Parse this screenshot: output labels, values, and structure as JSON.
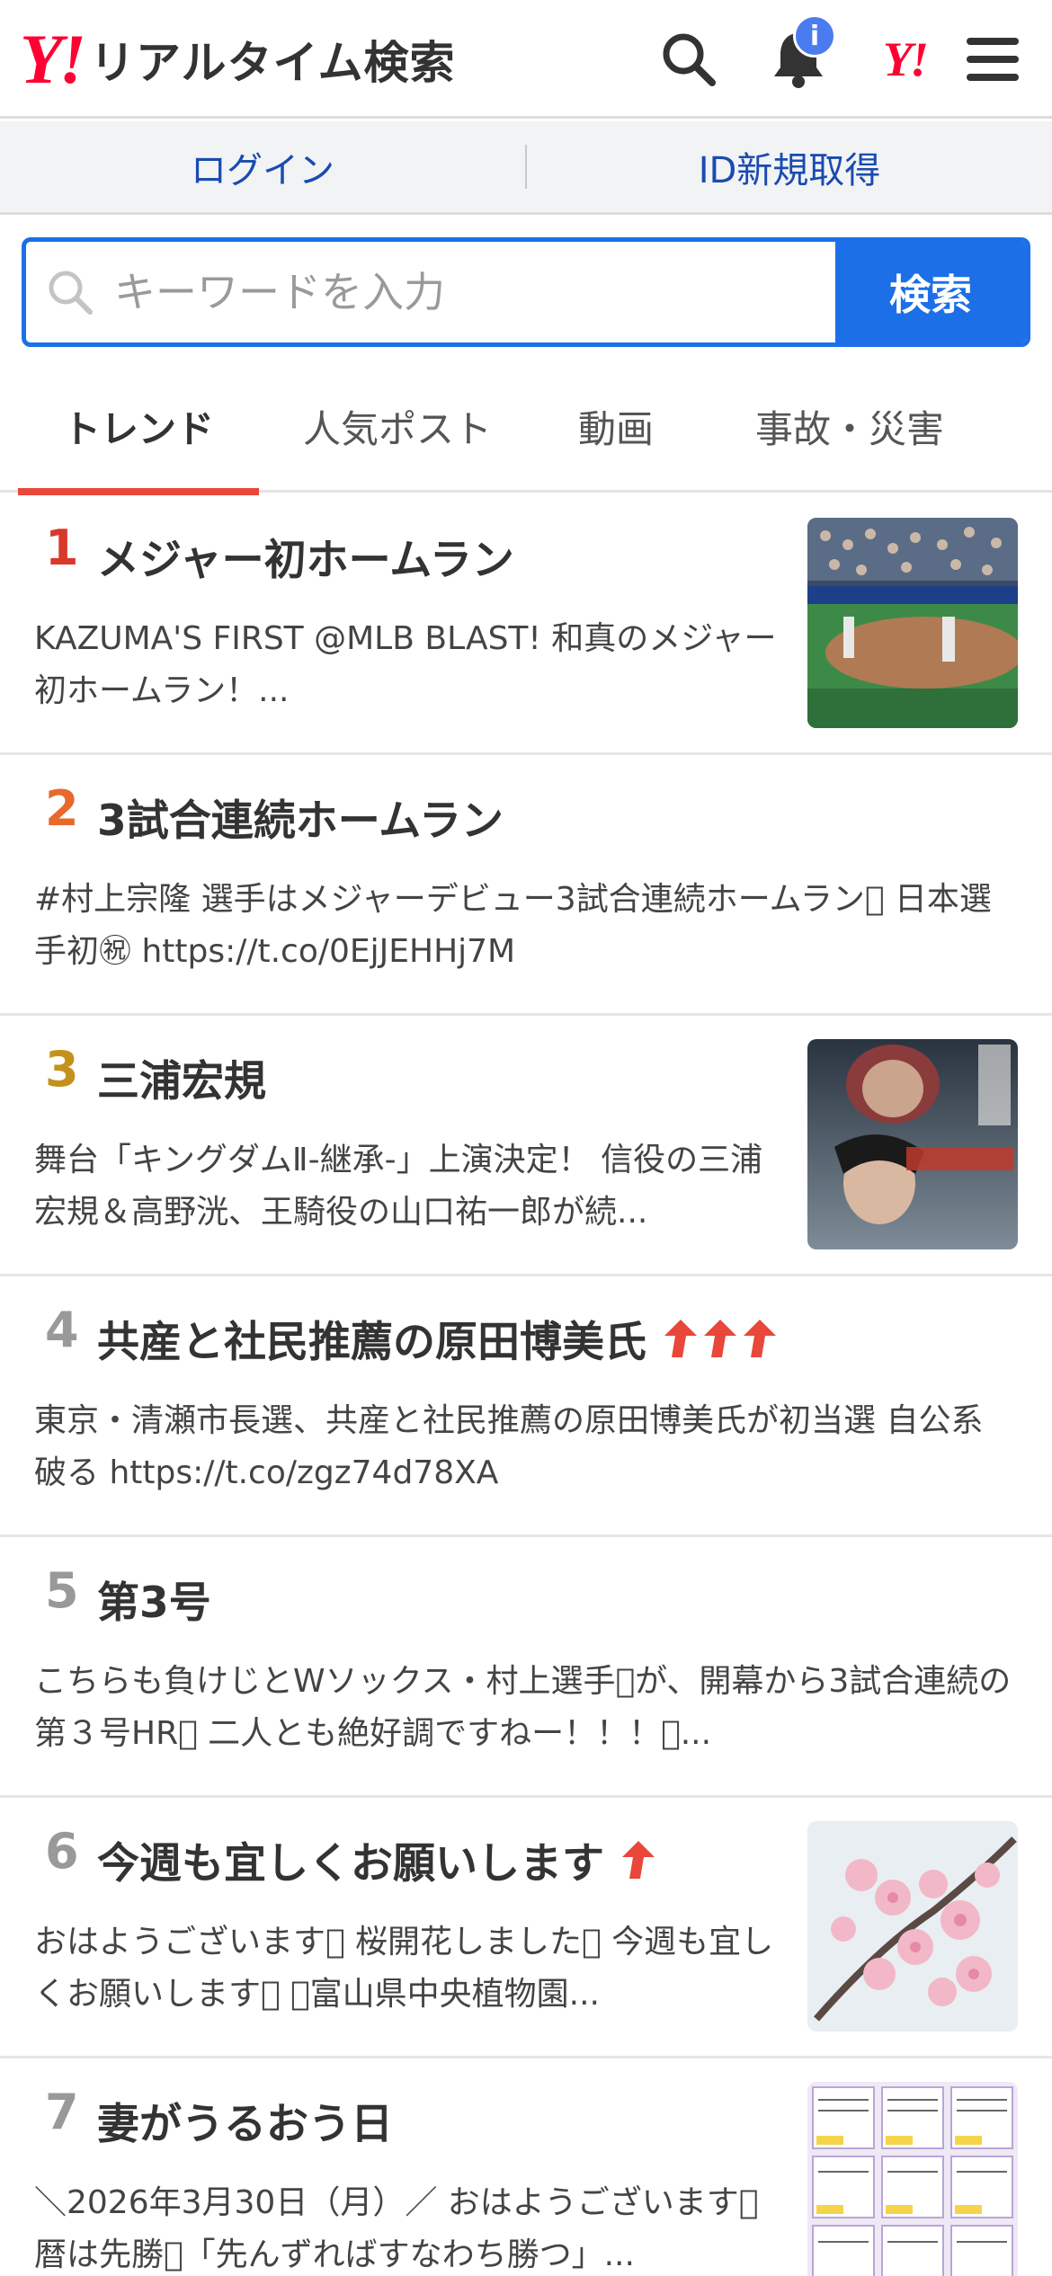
{
  "header": {
    "logo_mark": "Y!",
    "logo_text": "リアルタイム検索",
    "notification_badge": "i",
    "yahoo_mark": "Y!",
    "accent_color": "#ff0033"
  },
  "auth": {
    "login_label": "ログイン",
    "signup_label": "ID新規取得"
  },
  "search": {
    "placeholder": "キーワードを入力",
    "button_label": "検索"
  },
  "tabs": [
    {
      "label": "トレンド",
      "active": true
    },
    {
      "label": "人気ポスト",
      "active": false
    },
    {
      "label": "動画",
      "active": false
    },
    {
      "label": "事故・災害",
      "active": false
    }
  ],
  "trends": [
    {
      "rank": "1",
      "rank_color": "#d9392b",
      "title": "メジャー初ホームラン",
      "description": "KAZUMA'S FIRST @MLB BLAST! 和真のメジャー初ホームラン！...",
      "thumbnail": "baseball-field-image",
      "up_arrows": 0
    },
    {
      "rank": "2",
      "rank_color": "#e8682e",
      "title": "3試合連続ホームラン",
      "description": "#村上宗隆 選手はメジャーデビュー3試合連続ホームラン󾭂 日本選手初㊗ https://t.co/0EjJEHHj7M",
      "thumbnail": "",
      "up_arrows": 0
    },
    {
      "rank": "3",
      "rank_color": "#c4911c",
      "title": "三浦宏規",
      "description": "舞台「キングダムⅡ-継承-」上演決定！ 信役の三浦宏規＆高野洸、王騎役の山口祐一郎が続...",
      "thumbnail": "stage-poster-image",
      "up_arrows": 0
    },
    {
      "rank": "4",
      "rank_color": "#999999",
      "title": "共産と社民推薦の原田博美氏",
      "description": "東京・清瀬市長選、共産と社民推薦の原田博美氏が初当選 自公系破る https://t.co/zgz74d78XA",
      "thumbnail": "",
      "up_arrows": 3
    },
    {
      "rank": "5",
      "rank_color": "#999999",
      "title": "第3号",
      "description": "こちらも負けじとWソックス・村上選手󾓶が、開幕から3試合連続の第３号HR󾭂 二人とも絶好調ですねー！！！󾭂...",
      "thumbnail": "",
      "up_arrows": 0
    },
    {
      "rank": "6",
      "rank_color": "#999999",
      "title": "今週も宜しくお願いします",
      "description": "おはようございます󾭂 桜開花しました󾭂 今週も宜しくお願いします󾭂 ＃富山県中央植物園...",
      "thumbnail": "cherry-blossom-image",
      "up_arrows": 1
    },
    {
      "rank": "7",
      "rank_color": "#999999",
      "title": "妻がうるおう日",
      "description": "＼2026年3月30日（月）／ おはようございます󾭂 暦は先勝󾭂「先んずればすなわち勝つ」...",
      "thumbnail": "horoscope-grid-image",
      "up_arrows": 0
    }
  ]
}
